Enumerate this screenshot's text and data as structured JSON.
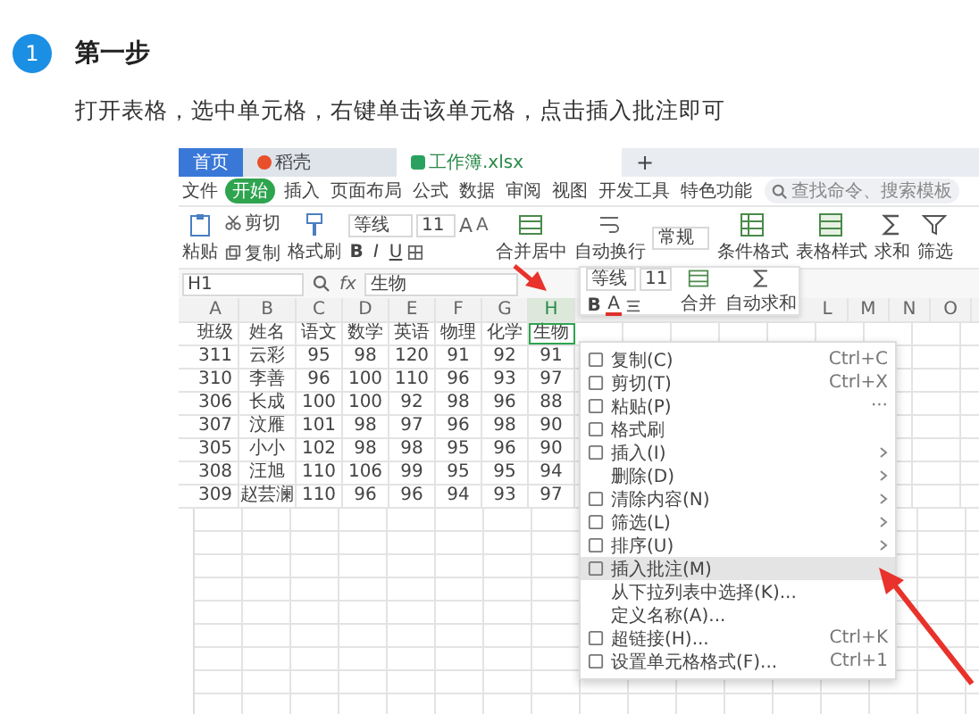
{
  "step": {
    "number": "1",
    "title": "第一步"
  },
  "instruction": "打开表格，选中单元格，右键单击该单元格，点击插入批注即可",
  "tabs": [
    {
      "label": "首页",
      "kind": "home",
      "selected": false
    },
    {
      "label": "稻壳",
      "kind": "docer",
      "selected": false
    },
    {
      "label": "工作簿.xlsx",
      "kind": "sheet",
      "selected": true
    }
  ],
  "new_tab": "+",
  "file_menu": "文件",
  "ribbon_tabs": [
    {
      "label": "开始",
      "selected": true
    },
    {
      "label": "插入",
      "selected": false
    },
    {
      "label": "页面布局",
      "selected": false
    },
    {
      "label": "公式",
      "selected": false
    },
    {
      "label": "数据",
      "selected": false
    },
    {
      "label": "审阅",
      "selected": false
    },
    {
      "label": "视图",
      "selected": false
    },
    {
      "label": "开发工具",
      "selected": false
    },
    {
      "label": "特色功能",
      "selected": false
    }
  ],
  "search": {
    "placeholder": "查找命令、搜索模板"
  },
  "toolbar": {
    "paste": "粘贴",
    "cut": "剪切",
    "copy": "复制",
    "format_painter": "格式刷",
    "font": "等线",
    "size": "11",
    "grow": "A",
    "shrink": "A",
    "styles": [
      "B",
      "I",
      "U"
    ],
    "merge": "合并居中",
    "wrap": "自动换行",
    "number_format": "常规",
    "conditional": "条件格式",
    "table_style": "表格样式",
    "sum": "求和",
    "filter": "筛选"
  },
  "formula_bar": {
    "cell": "H1",
    "function_label": "fx",
    "value": "生物"
  },
  "columns": [
    {
      "label": "A",
      "selected": false
    },
    {
      "label": "B",
      "selected": false
    },
    {
      "label": "C",
      "selected": false
    },
    {
      "label": "D",
      "selected": false
    },
    {
      "label": "E",
      "selected": false
    },
    {
      "label": "F",
      "selected": false
    },
    {
      "label": "G",
      "selected": false
    },
    {
      "label": "H",
      "selected": true
    }
  ],
  "far_columns": [
    "L",
    "M",
    "N",
    "O"
  ],
  "header_row": [
    {
      "text": "班级",
      "selected": false
    },
    {
      "text": "姓名",
      "selected": false
    },
    {
      "text": "语文",
      "selected": false
    },
    {
      "text": "数学",
      "selected": false
    },
    {
      "text": "英语",
      "selected": false
    },
    {
      "text": "物理",
      "selected": false
    },
    {
      "text": "化学",
      "selected": false
    },
    {
      "text": "生物",
      "selected": true
    }
  ],
  "rows": [
    [
      "311",
      "云彩",
      "95",
      "98",
      "120",
      "91",
      "92",
      "91"
    ],
    [
      "310",
      "李善",
      "96",
      "100",
      "110",
      "96",
      "93",
      "97"
    ],
    [
      "306",
      "长成",
      "100",
      "100",
      "92",
      "98",
      "96",
      "88"
    ],
    [
      "307",
      "汶雁",
      "101",
      "98",
      "97",
      "96",
      "98",
      "90"
    ],
    [
      "305",
      "小小",
      "102",
      "98",
      "98",
      "95",
      "96",
      "90"
    ],
    [
      "308",
      "汪旭",
      "110",
      "106",
      "99",
      "95",
      "95",
      "94"
    ],
    [
      "309",
      "赵芸澜",
      "110",
      "96",
      "96",
      "94",
      "93",
      "97"
    ]
  ],
  "mini_toolbar": {
    "font": "等线",
    "size": "11",
    "bold": "B",
    "font_color": "A",
    "merge": "合并",
    "sum": "自动求和"
  },
  "context_menu": [
    {
      "label": "复制(C)",
      "shortcut": "Ctrl+C",
      "icon": true,
      "submenu": false,
      "hovered": false
    },
    {
      "label": "剪切(T)",
      "shortcut": "Ctrl+X",
      "icon": true,
      "submenu": false,
      "hovered": false
    },
    {
      "label": "粘贴(P)",
      "extra": "···",
      "icon": true,
      "submenu": false,
      "hovered": false
    },
    {
      "label": "格式刷",
      "icon": true,
      "submenu": false,
      "hovered": false
    },
    {
      "label": "插入(I)",
      "icon": true,
      "submenu": true,
      "hovered": false
    },
    {
      "label": "删除(D)",
      "icon": false,
      "submenu": true,
      "hovered": false
    },
    {
      "label": "清除内容(N)",
      "icon": true,
      "submenu": true,
      "hovered": false
    },
    {
      "label": "筛选(L)",
      "icon": true,
      "submenu": true,
      "hovered": false
    },
    {
      "label": "排序(U)",
      "icon": true,
      "submenu": true,
      "hovered": false
    },
    {
      "label": "插入批注(M)",
      "icon": true,
      "submenu": false,
      "hovered": true
    },
    {
      "label": "从下拉列表中选择(K)...",
      "icon": false,
      "submenu": false,
      "hovered": false
    },
    {
      "label": "定义名称(A)...",
      "icon": false,
      "submenu": false,
      "hovered": false
    },
    {
      "label": "超链接(H)...",
      "shortcut": "Ctrl+K",
      "icon": true,
      "submenu": false,
      "hovered": false
    },
    {
      "label": "设置单元格格式(F)...",
      "shortcut": "Ctrl+1",
      "icon": true,
      "submenu": false,
      "hovered": false
    }
  ]
}
